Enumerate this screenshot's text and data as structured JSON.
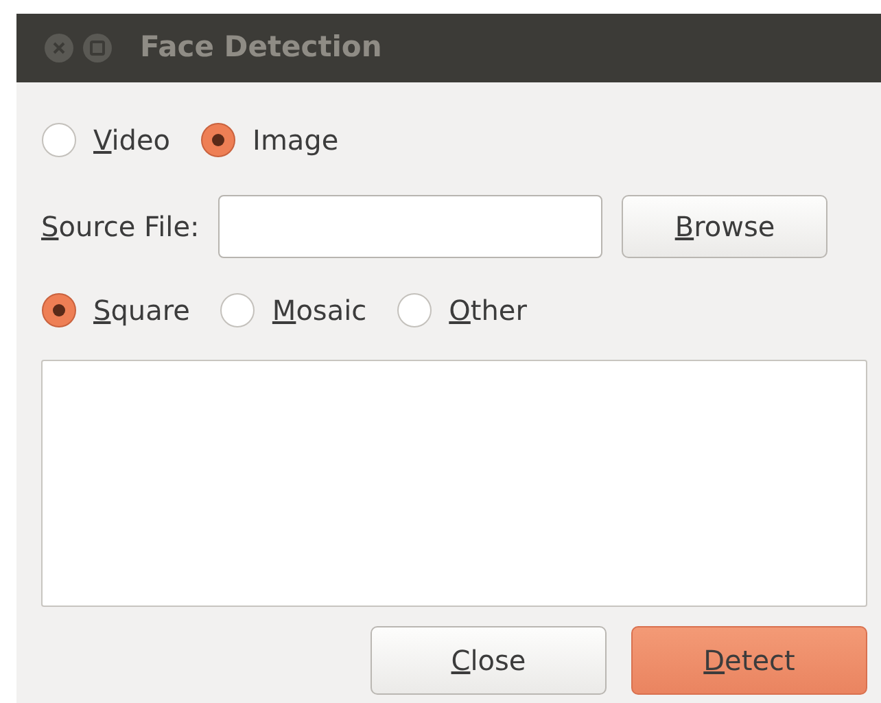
{
  "window": {
    "title": "Face Detection"
  },
  "source_type": [
    {
      "label": "Video",
      "mnemonic": true,
      "selected": false
    },
    {
      "label": "Image",
      "mnemonic": false,
      "selected": true
    }
  ],
  "source_file": {
    "label": "Source File:",
    "mnemonic": true
  },
  "browse_button": {
    "label": "Browse",
    "mnemonic": true
  },
  "effect": [
    {
      "label": "Square",
      "mnemonic": true,
      "selected": true
    },
    {
      "label": "Mosaic",
      "mnemonic": true,
      "selected": false
    },
    {
      "label": "Other",
      "mnemonic": true,
      "selected": false
    }
  ],
  "buttons": [
    {
      "label": "Close",
      "mnemonic": true,
      "kind": "default"
    },
    {
      "label": "Detect",
      "mnemonic": true,
      "kind": "suggested"
    }
  ]
}
